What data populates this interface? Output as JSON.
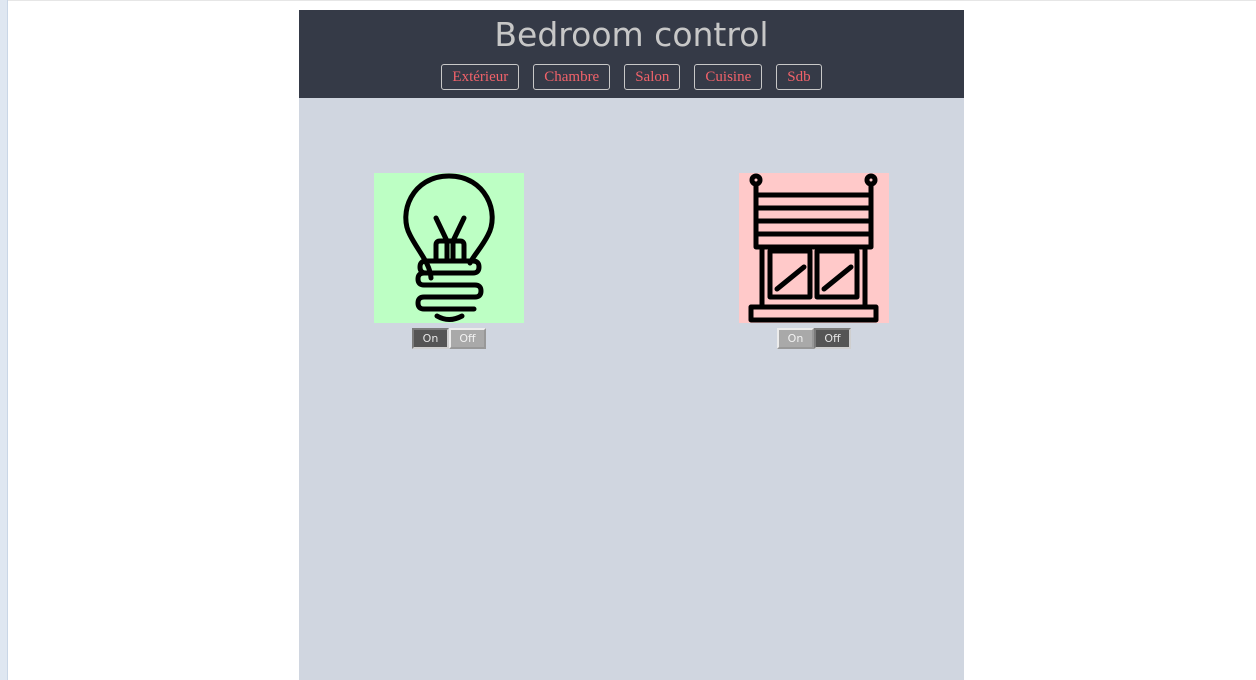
{
  "header": {
    "title": "Bedroom control"
  },
  "nav": {
    "items": [
      {
        "label": "Extérieur"
      },
      {
        "label": "Chambre"
      },
      {
        "label": "Salon"
      },
      {
        "label": "Cuisine"
      },
      {
        "label": "Sdb"
      }
    ]
  },
  "devices": [
    {
      "icon": "lightbulb-icon",
      "state": "on",
      "bg_color": "#bdffc4",
      "on_label": "On",
      "off_label": "Off"
    },
    {
      "icon": "window-blind-icon",
      "state": "off",
      "bg_color": "#ffc9c9",
      "on_label": "On",
      "off_label": "Off"
    }
  ],
  "colors": {
    "header_bg": "#353a47",
    "panel_bg": "#d0d6e0",
    "nav_text": "#f1626a",
    "title_text": "#c7c7c7"
  }
}
